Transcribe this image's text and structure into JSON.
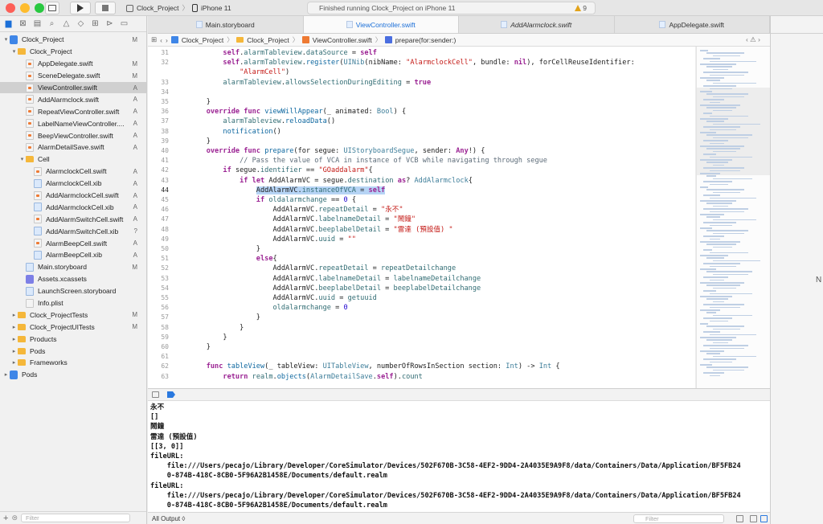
{
  "toolbar": {
    "scheme_project": "Clock_Project",
    "scheme_device": "iPhone 11",
    "status_text": "Finished running Clock_Project on iPhone 11",
    "warning_count": "9"
  },
  "navigator": {
    "items": [
      {
        "label": "Clock_Project",
        "indent": 0,
        "icon": "proj",
        "disclosure": "▾",
        "tag": "M"
      },
      {
        "label": "Clock_Project",
        "indent": 1,
        "icon": "folder",
        "disclosure": "▾",
        "tag": ""
      },
      {
        "label": "AppDelegate.swift",
        "indent": 2,
        "icon": "swift",
        "disclosure": "",
        "tag": "M"
      },
      {
        "label": "SceneDelegate.swift",
        "indent": 2,
        "icon": "swift",
        "disclosure": "",
        "tag": "M"
      },
      {
        "label": "ViewController.swift",
        "indent": 2,
        "icon": "swift",
        "disclosure": "",
        "tag": "A",
        "selected": true
      },
      {
        "label": "AddAlarmclock.swift",
        "indent": 2,
        "icon": "swift",
        "disclosure": "",
        "tag": "A"
      },
      {
        "label": "RepeatViewController.swift",
        "indent": 2,
        "icon": "swift",
        "disclosure": "",
        "tag": "A"
      },
      {
        "label": "LabelNameViewController....",
        "indent": 2,
        "icon": "swift",
        "disclosure": "",
        "tag": "A"
      },
      {
        "label": "BeepViewController.swift",
        "indent": 2,
        "icon": "swift",
        "disclosure": "",
        "tag": "A"
      },
      {
        "label": "AlarmDetailSave.swift",
        "indent": 2,
        "icon": "swift",
        "disclosure": "",
        "tag": "A"
      },
      {
        "label": "Cell",
        "indent": 2,
        "icon": "folder",
        "disclosure": "▾",
        "tag": ""
      },
      {
        "label": "AlarmclockCell.swift",
        "indent": 3,
        "icon": "swift",
        "disclosure": "",
        "tag": "A"
      },
      {
        "label": "AlarmclockCell.xib",
        "indent": 3,
        "icon": "xib",
        "disclosure": "",
        "tag": "A"
      },
      {
        "label": "AddAlarmclockCell.swift",
        "indent": 3,
        "icon": "swift",
        "disclosure": "",
        "tag": "A"
      },
      {
        "label": "AddAlarmclockCell.xib",
        "indent": 3,
        "icon": "xib",
        "disclosure": "",
        "tag": "A"
      },
      {
        "label": "AddAlarmSwitchCell.swift",
        "indent": 3,
        "icon": "swift",
        "disclosure": "",
        "tag": "A"
      },
      {
        "label": "AddAlarmSwitchCell.xib",
        "indent": 3,
        "icon": "xib",
        "disclosure": "",
        "tag": "?"
      },
      {
        "label": "AlarmBeepCell.swift",
        "indent": 3,
        "icon": "swift",
        "disclosure": "",
        "tag": "A"
      },
      {
        "label": "AlarmBeepCell.xib",
        "indent": 3,
        "icon": "xib",
        "disclosure": "",
        "tag": "A"
      },
      {
        "label": "Main.storyboard",
        "indent": 2,
        "icon": "sb",
        "disclosure": "",
        "tag": "M"
      },
      {
        "label": "Assets.xcassets",
        "indent": 2,
        "icon": "xca",
        "disclosure": "",
        "tag": ""
      },
      {
        "label": "LaunchScreen.storyboard",
        "indent": 2,
        "icon": "sb",
        "disclosure": "",
        "tag": ""
      },
      {
        "label": "Info.plist",
        "indent": 2,
        "icon": "plist",
        "disclosure": "",
        "tag": ""
      },
      {
        "label": "Clock_ProjectTests",
        "indent": 1,
        "icon": "folder",
        "disclosure": "▸",
        "tag": "M"
      },
      {
        "label": "Clock_ProjectUITests",
        "indent": 1,
        "icon": "folder",
        "disclosure": "▸",
        "tag": "M"
      },
      {
        "label": "Products",
        "indent": 1,
        "icon": "folder",
        "disclosure": "▸",
        "tag": ""
      },
      {
        "label": "Pods",
        "indent": 1,
        "icon": "folder",
        "disclosure": "▸",
        "tag": ""
      },
      {
        "label": "Frameworks",
        "indent": 1,
        "icon": "folder",
        "disclosure": "▸",
        "tag": ""
      },
      {
        "label": "Pods",
        "indent": 0,
        "icon": "pods",
        "disclosure": "▸",
        "tag": ""
      }
    ],
    "filter_placeholder": "Filter"
  },
  "tabs": [
    {
      "label": "Main.storyboard",
      "active": false,
      "italic": false
    },
    {
      "label": "ViewController.swift",
      "active": true,
      "italic": false
    },
    {
      "label": "AddAlarmclock.swift",
      "active": false,
      "italic": true
    },
    {
      "label": "AppDelegate.swift",
      "active": false,
      "italic": false
    }
  ],
  "jumpbar": {
    "crumbs": [
      "Clock_Project",
      "Clock_Project",
      "ViewController.swift",
      "prepare(for:sender:)"
    ]
  },
  "code": [
    {
      "n": "31",
      "html": "        <span class=\"kw\">self</span>.<span class=\"pr\">alarmTableview</span>.<span class=\"pr\">dataSource</span> = <span class=\"kw\">self</span>"
    },
    {
      "n": "32",
      "html": "        <span class=\"kw\">self</span>.<span class=\"pr\">alarmTableview</span>.<span class=\"fn\">register</span>(<span class=\"ty\">UINib</span>(nibName: <span class=\"st\">\"AlarmclockCell\"</span>, bundle: <span class=\"kw\">nil</span>), forCellReuseIdentifier:"
    },
    {
      "n": "",
      "html": "            <span class=\"st\">\"AlarmCell\"</span>)"
    },
    {
      "n": "33",
      "html": "        <span class=\"pr\">alarmTableview</span>.<span class=\"pr\">allowsSelectionDuringEditing</span> = <span class=\"kw\">true</span>"
    },
    {
      "n": "34",
      "html": ""
    },
    {
      "n": "35",
      "html": "    }"
    },
    {
      "n": "36",
      "html": "    <span class=\"kw\">override</span> <span class=\"kw\">func</span> <span class=\"fn\">viewWillAppear</span>(_ animated: <span class=\"ty\">Bool</span>) {"
    },
    {
      "n": "37",
      "html": "        <span class=\"pr\">alarmTableview</span>.<span class=\"fn\">reloadData</span>()"
    },
    {
      "n": "38",
      "html": "        <span class=\"fn\">notification</span>()"
    },
    {
      "n": "39",
      "html": "    }"
    },
    {
      "n": "40",
      "html": "    <span class=\"kw\">override</span> <span class=\"kw\">func</span> <span class=\"fn\">prepare</span>(for segue: <span class=\"ty\">UIStoryboardSegue</span>, sender: <span class=\"kw\">Any</span>!) {"
    },
    {
      "n": "41",
      "html": "            <span class=\"cm\">// Pass the value of VCA in instance of VCB while navigating through segue</span>"
    },
    {
      "n": "42",
      "html": "        <span class=\"kw\">if</span> segue.<span class=\"pr\">identifier</span> == <span class=\"st\">\"GOaddalarm\"</span>{"
    },
    {
      "n": "43",
      "html": "            <span class=\"kw\">if</span> <span class=\"kw\">let</span> AddAlarmVC = segue.<span class=\"pr\">destination</span> <span class=\"kw\">as</span>? <span class=\"ty\">AddAlarmclock</span>{"
    },
    {
      "n": "44",
      "html": "                <span class=\"hl\">AddAlarmVC.<span class=\"pr\">instanceOfVCA</span> = <span class=\"kw\">self</span></span>",
      "cur": true
    },
    {
      "n": "45",
      "html": "                <span class=\"kw\">if</span> <span class=\"pr\">oldalarmchange</span> == <span class=\"nu\">0</span> {"
    },
    {
      "n": "46",
      "html": "                    AddAlarmVC.<span class=\"pr\">repeatDetail</span> = <span class=\"st\">\"永不\"</span>"
    },
    {
      "n": "47",
      "html": "                    AddAlarmVC.<span class=\"pr\">labelnameDetail</span> = <span class=\"st\">\"鬧鐘\"</span>"
    },
    {
      "n": "48",
      "html": "                    AddAlarmVC.<span class=\"pr\">beeplabelDetail</span> = <span class=\"st\">\"雷達 (預設值) \"</span>"
    },
    {
      "n": "49",
      "html": "                    AddAlarmVC.<span class=\"pr\">uuid</span> = <span class=\"st\">\"\"</span>"
    },
    {
      "n": "50",
      "html": "                }"
    },
    {
      "n": "51",
      "html": "                <span class=\"kw\">else</span>{"
    },
    {
      "n": "52",
      "html": "                    AddAlarmVC.<span class=\"pr\">repeatDetail</span> = <span class=\"pr\">repeatDetailchange</span>"
    },
    {
      "n": "53",
      "html": "                    AddAlarmVC.<span class=\"pr\">labelnameDetail</span> = <span class=\"pr\">labelnameDetailchange</span>"
    },
    {
      "n": "54",
      "html": "                    AddAlarmVC.<span class=\"pr\">beeplabelDetail</span> = <span class=\"pr\">beeplabelDetailchange</span>"
    },
    {
      "n": "55",
      "html": "                    AddAlarmVC.<span class=\"pr\">uuid</span> = <span class=\"pr\">getuuid</span>"
    },
    {
      "n": "56",
      "html": "                    <span class=\"pr\">oldalarmchange</span> = <span class=\"nu\">0</span>"
    },
    {
      "n": "57",
      "html": "                }"
    },
    {
      "n": "58",
      "html": "            }"
    },
    {
      "n": "59",
      "html": "        }"
    },
    {
      "n": "60",
      "html": "    }"
    },
    {
      "n": "61",
      "html": ""
    },
    {
      "n": "62",
      "html": "    <span class=\"kw\">func</span> <span class=\"fn\">tableView</span>(_ tableView: <span class=\"ty\">UITableView</span>, numberOfRowsInSection section: <span class=\"ty\">Int</span>) -> <span class=\"ty\">Int</span> {"
    },
    {
      "n": "63",
      "html": "        <span class=\"kw\">return</span> <span class=\"pr\">realm</span>.<span class=\"fn\">objects</span>(<span class=\"ty\">AlarmDetailSave</span>.<span class=\"kw\">self</span>).<span class=\"pr\">count</span>"
    }
  ],
  "console": [
    "永不",
    "[]",
    "鬧鐘",
    "雷達 (預設值)",
    "[[3, 0]]",
    "fileURL:",
    "    file:///Users/pecajo/Library/Developer/CoreSimulator/Devices/502F670B-3C58-4EF2-9DD4-2A4035E9A9F8/data/Containers/Data/Application/BF5FB24",
    "    0-874B-418C-8CB0-5F96A2B1458E/Documents/default.realm",
    "fileURL:",
    "    file:///Users/pecajo/Library/Developer/CoreSimulator/Devices/502F670B-3C58-4EF2-9DD4-2A4035E9A9F8/data/Containers/Data/Application/BF5FB24",
    "    0-874B-418C-8CB0-5F96A2B1458E/Documents/default.realm"
  ],
  "bottombar": {
    "output_selector": "All Output ◊",
    "filter_placeholder": "Filter"
  },
  "rightpane": {
    "text": "N"
  }
}
